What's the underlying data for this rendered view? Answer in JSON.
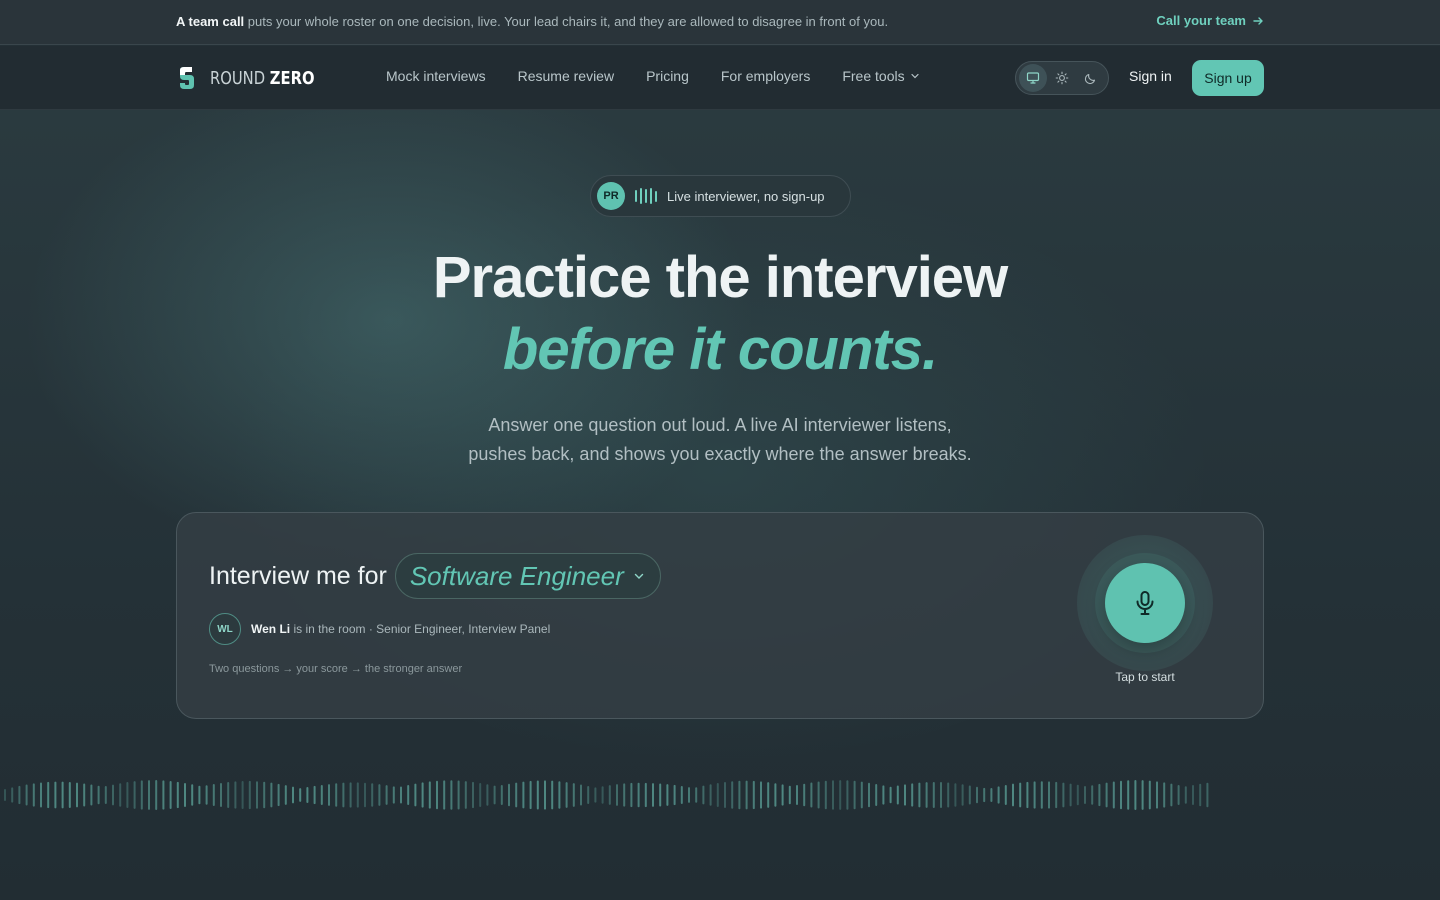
{
  "announcement": {
    "lead": "A team call",
    "text": " puts your whole roster on one decision, live. Your lead chairs it, and they are allowed to disagree in front of you.",
    "cta": "Call your team"
  },
  "nav": {
    "logo_light": "ROUND",
    "logo_bold": "ZERO",
    "links": [
      "Mock interviews",
      "Resume review",
      "Pricing",
      "For employers",
      "Free tools"
    ],
    "theme_options": [
      "system",
      "light",
      "dark"
    ],
    "theme_selected": "system",
    "signin": "Sign in",
    "signup": "Sign up"
  },
  "hero": {
    "pill_avatar": "PR",
    "pill_text": "Live interviewer, no sign-up",
    "title": "Practice the interview",
    "title_accent": "before it counts.",
    "subtitle_line1": "Answer one question out loud. A live AI interviewer listens,",
    "subtitle_line2": "pushes back, and shows you exactly where the answer breaks."
  },
  "card": {
    "lead": "Interview me for",
    "role": "Software Engineer",
    "interviewer_initials": "WL",
    "interviewer_name": "Wen Li",
    "interviewer_rest": " is in the room · Senior Engineer, Interview Panel",
    "steps": "Two questions → your score → the stronger answer",
    "mic_label": "Tap to start"
  },
  "colors": {
    "accent": "#62c6b4",
    "background": "#243036"
  }
}
